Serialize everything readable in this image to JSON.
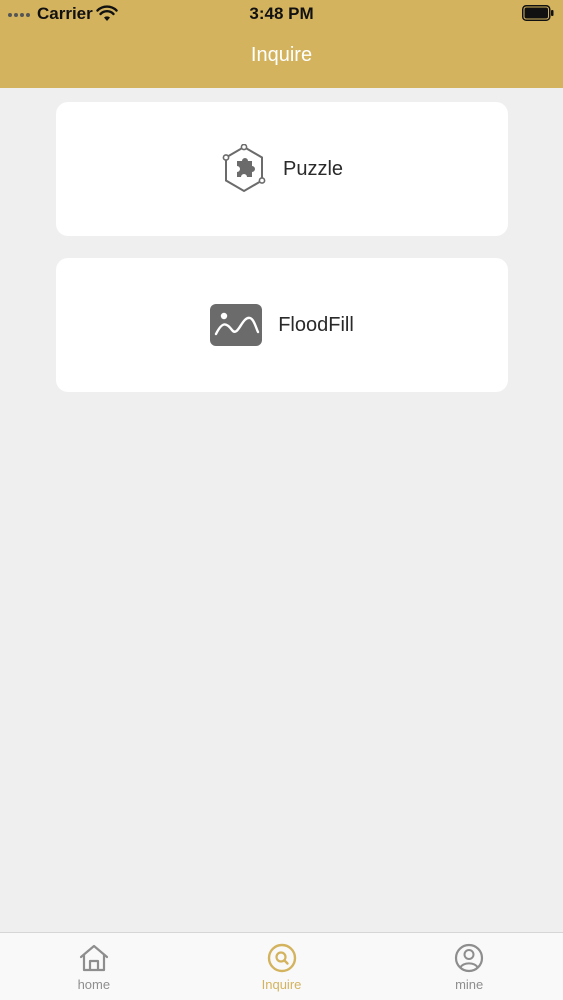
{
  "status_bar": {
    "carrier": "Carrier",
    "time": "3:48 PM",
    "icons": [
      "signal-dots-icon",
      "wifi-icon",
      "battery-icon"
    ]
  },
  "nav": {
    "title": "Inquire"
  },
  "cards": [
    {
      "label": "Puzzle",
      "icon": "puzzle-icon"
    },
    {
      "label": "FloodFill",
      "icon": "image-icon"
    }
  ],
  "tabbar": {
    "tabs": [
      {
        "label": "home",
        "icon": "home-icon",
        "active": false
      },
      {
        "label": "Inquire",
        "icon": "search-icon",
        "active": true
      },
      {
        "label": "mine",
        "icon": "user-icon",
        "active": false
      }
    ]
  },
  "colors": {
    "accent": "#d4b35f",
    "background": "#f0efef",
    "card": "#ffffff",
    "inactive_tab": "#8e8e8e"
  }
}
